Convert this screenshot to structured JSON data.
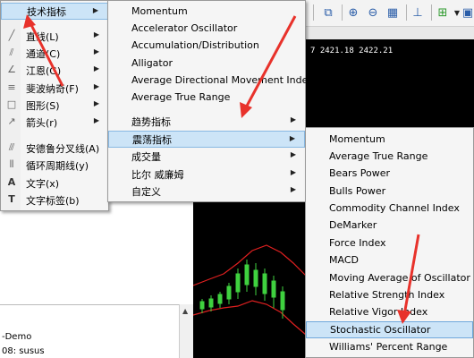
{
  "top_menu": {
    "label": "技术指标",
    "items": [
      {
        "label": "直线(L)",
        "icon": "line-icon"
      },
      {
        "label": "通道(C)",
        "icon": "channel-icon"
      },
      {
        "label": "江恩(G)",
        "icon": "gann-icon"
      },
      {
        "label": "斐波纳奇(F)",
        "icon": "fibonacci-icon"
      },
      {
        "label": "图形(S)",
        "icon": "shapes-icon"
      },
      {
        "label": "箭头(r)",
        "icon": "arrow-icon"
      },
      {
        "label": "安德鲁分叉线(A)",
        "icon": "pitchfork-icon"
      },
      {
        "label": "循环周期线(y)",
        "icon": "cycle-lines-icon"
      },
      {
        "label": "文字(x)",
        "icon": "text-icon"
      },
      {
        "label": "文字标签(b)",
        "icon": "text-label-icon"
      }
    ]
  },
  "indicator_menu": {
    "items": [
      {
        "label": "Momentum"
      },
      {
        "label": "Accelerator Oscillator"
      },
      {
        "label": "Accumulation/Distribution"
      },
      {
        "label": "Alligator"
      },
      {
        "label": "Average Directional Movement Index"
      },
      {
        "label": "Average True Range"
      },
      {
        "label": "趋势指标"
      },
      {
        "label": "震荡指标"
      },
      {
        "label": "成交量"
      },
      {
        "label": "比尔 威廉姆"
      },
      {
        "label": "自定义"
      }
    ]
  },
  "oscillator_menu": {
    "items": [
      {
        "label": "Momentum"
      },
      {
        "label": "Average True Range"
      },
      {
        "label": "Bears Power"
      },
      {
        "label": "Bulls Power"
      },
      {
        "label": "Commodity Channel Index"
      },
      {
        "label": "DeMarker"
      },
      {
        "label": "Force Index"
      },
      {
        "label": "MACD"
      },
      {
        "label": "Moving Average of Oscillator"
      },
      {
        "label": "Relative Strength Index"
      },
      {
        "label": "Relative Vigor Index"
      },
      {
        "label": "Stochastic Oscillator"
      },
      {
        "label": "Williams' Percent Range"
      }
    ]
  },
  "chart": {
    "price_readout": "7 2421.18 2422.21"
  },
  "bottom_panel": {
    "line1": "-Demo",
    "line2": "08: susus"
  },
  "colors": {
    "highlight": "#cce4f7",
    "arrow": "#e8322b",
    "candle_up": "#3fd13f",
    "band": "#e02020"
  }
}
